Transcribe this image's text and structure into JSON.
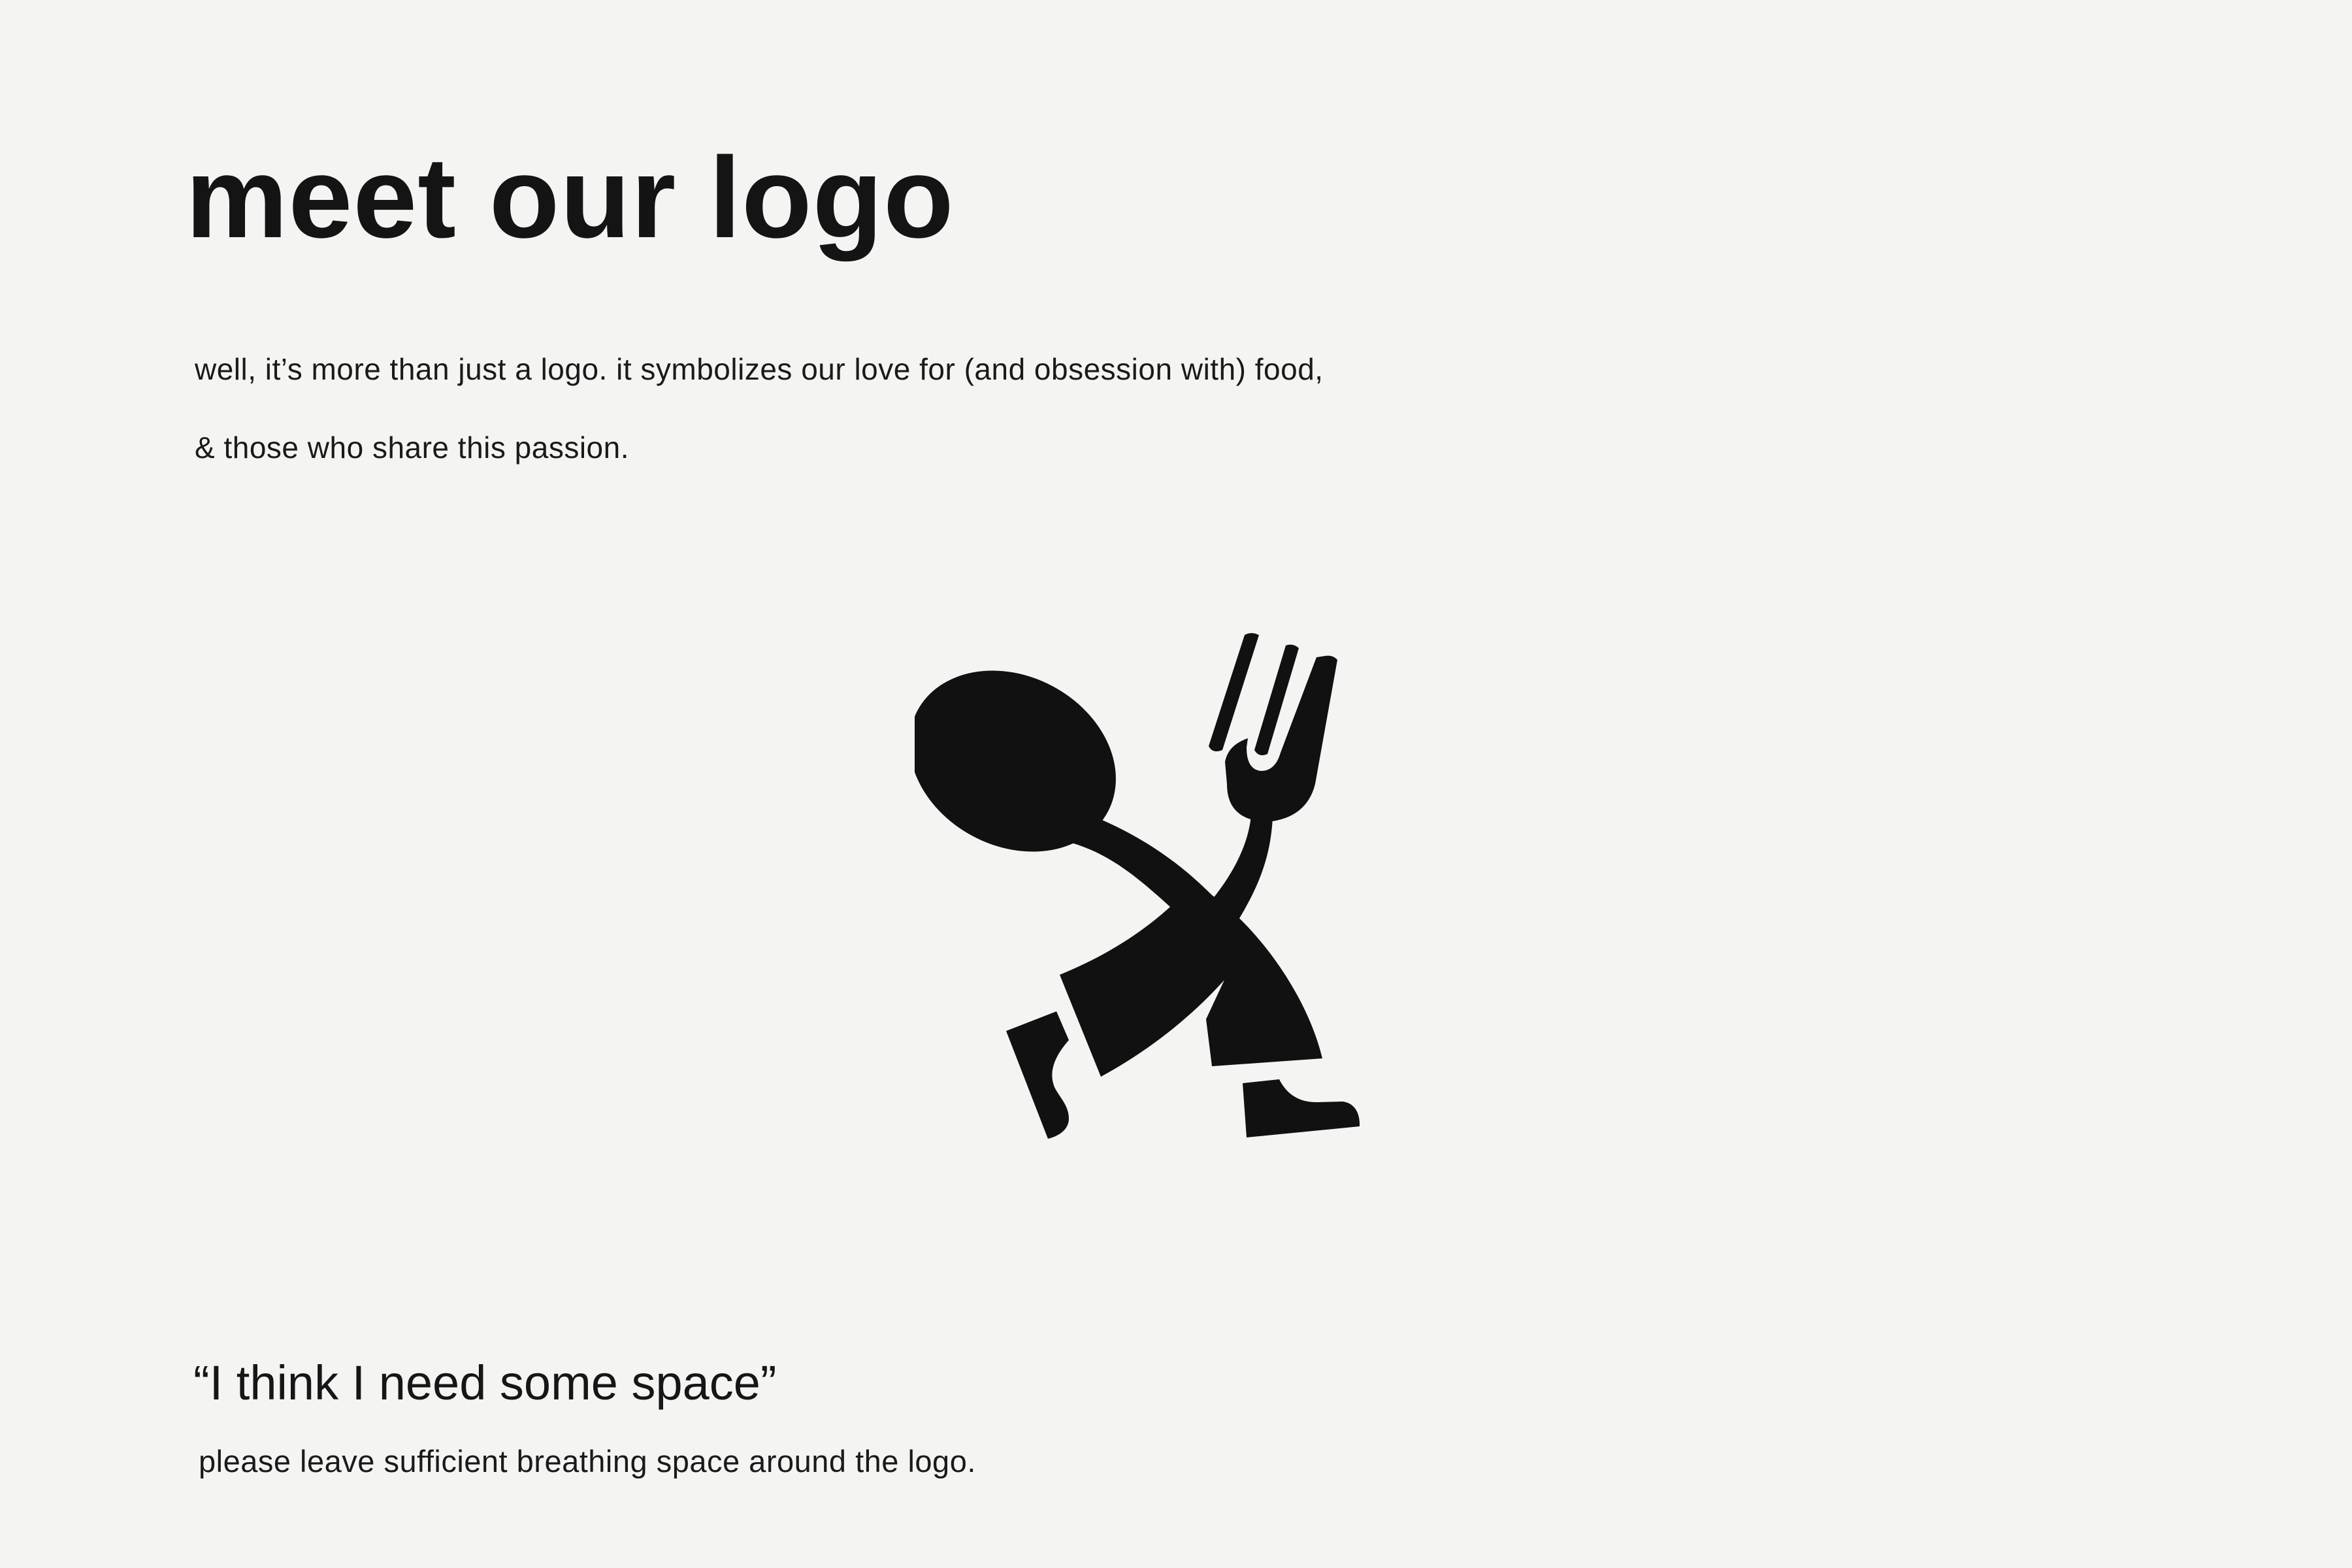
{
  "heading": "meet our logo",
  "intro": {
    "line1": "well, it’s more than just a logo. it symbolizes our love for (and obsession with) food,",
    "line2": "& those who share this passion."
  },
  "logo": {
    "icon": "walking-spoon-fork-logo",
    "color": "#111111"
  },
  "quote": "“I think I need some space”",
  "note": "please leave sufficient breathing space around the logo.",
  "colors": {
    "background": "#f4f4f2",
    "text": "#141414"
  }
}
